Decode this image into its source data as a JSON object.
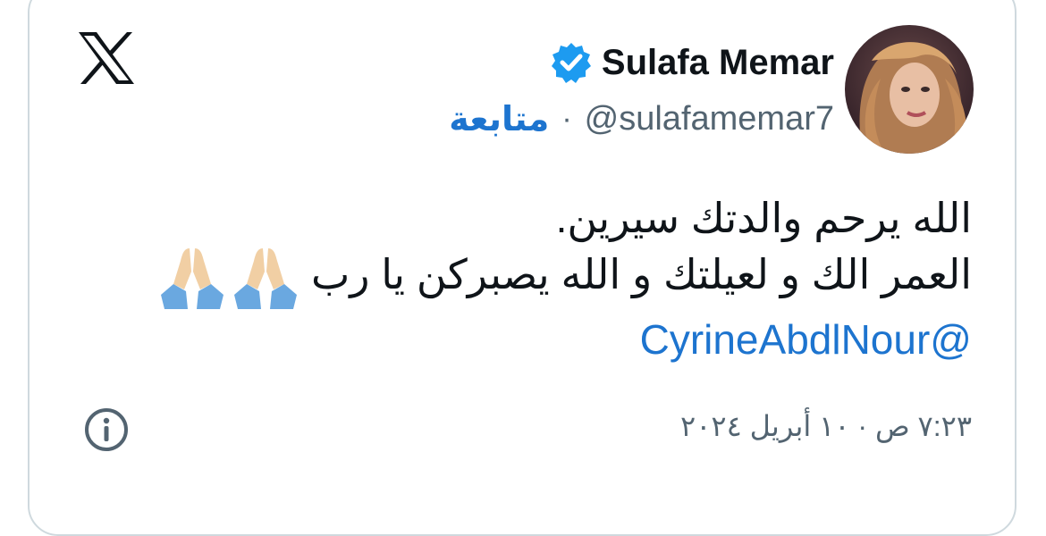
{
  "tweet": {
    "author_name": "Sulafa Memar",
    "handle": "@sulafamemar7",
    "separator": "·",
    "follow_label": "متابعة",
    "text_line1": "الله يرحم والدتك سيرين.",
    "text_line2": "العمر الك و لعيلتك و الله يصبركن يا رب",
    "mention": "@CyrineAbdlNour",
    "timestamp": "٧:٢٣ ص · ١٠ أبريل ٢٠٢٤",
    "emoji": "praying-hands-icon"
  },
  "colors": {
    "link": "#1d74cf",
    "verified": "#1d9bf0",
    "text": "#0f1419",
    "muted": "#536471",
    "border": "#cfd9de"
  }
}
